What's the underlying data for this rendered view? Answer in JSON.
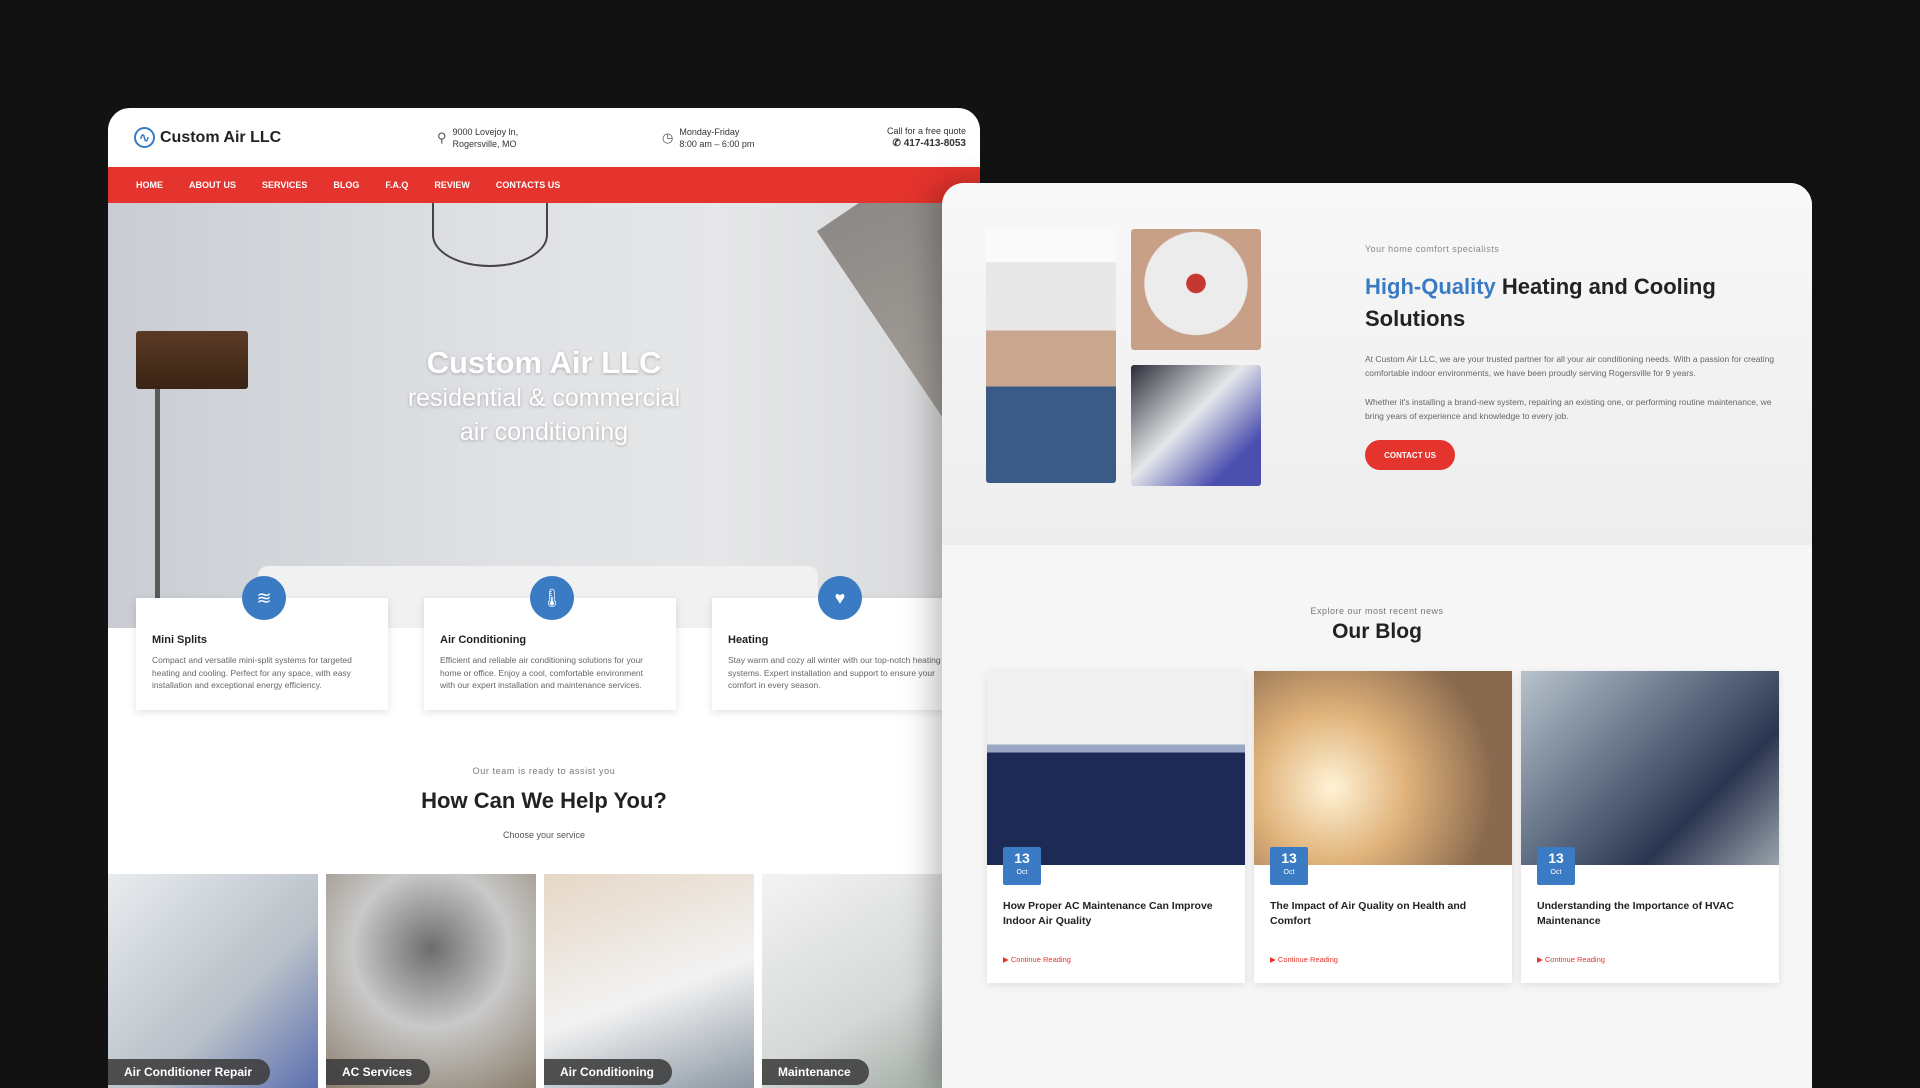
{
  "header": {
    "brand": "Custom Air LLC",
    "address_line1": "9000 Lovejoy ln,",
    "address_line2": "Rogersville, MO",
    "hours_line1": "Monday-Friday",
    "hours_line2": "8:00 am – 6:00 pm",
    "quote_label": "Call for a free quote",
    "phone": "417-413-8053"
  },
  "nav": [
    "HOME",
    "ABOUT US",
    "SERVICES",
    "BLOG",
    "F.A.Q",
    "REVIEW",
    "CONTACTS US"
  ],
  "hero": {
    "title": "Custom Air LLC",
    "subtitle_line1": "residential & commercial",
    "subtitle_line2": "air conditioning"
  },
  "features": [
    {
      "icon": "waves-icon",
      "glyph": "≋",
      "title": "Mini Splits",
      "text": "Compact and versatile mini-split systems for targeted heating and cooling. Perfect for any space, with easy installation and exceptional energy efficiency."
    },
    {
      "icon": "thermometer-icon",
      "glyph": "🌡",
      "title": "Air Conditioning",
      "text": "Efficient and reliable air conditioning solutions for your home or office. Enjoy a cool, comfortable environment with our expert installation and maintenance services."
    },
    {
      "icon": "heart-icon",
      "glyph": "♥",
      "title": "Heating",
      "text": "Stay warm and cozy all winter with our top-notch heating systems. Expert installation and support to ensure your comfort in every season."
    }
  ],
  "help": {
    "eyebrow": "Our team is ready to assist you",
    "title": "How Can We Help You?",
    "subtitle": "Choose your service"
  },
  "services": [
    "Air Conditioner Repair",
    "AC Services",
    "Air Conditioning",
    "Maintenance"
  ],
  "about": {
    "eyebrow": "Your home comfort specialists",
    "title_highlight": "High-Quality",
    "title_rest": " Heating and Cooling Solutions",
    "para1": "At Custom Air LLC, we are your trusted partner for all your air conditioning needs. With a passion for creating comfortable indoor environments, we have been proudly serving Rogersville for 9 years.",
    "para2": "Whether it's installing a brand-new system, repairing an existing one, or performing routine maintenance, we bring years of experience and knowledge to every job.",
    "cta": "CONTACT US"
  },
  "blog": {
    "eyebrow": "Explore our most recent news",
    "title": "Our Blog",
    "posts": [
      {
        "day": "13",
        "month": "Oct",
        "title": "How Proper AC Maintenance Can Improve Indoor Air Quality",
        "link": "Continue Reading"
      },
      {
        "day": "13",
        "month": "Oct",
        "title": "The Impact of Air Quality on Health and Comfort",
        "link": "Continue Reading"
      },
      {
        "day": "13",
        "month": "Oct",
        "title": "Understanding the Importance of HVAC Maintenance",
        "link": "Continue Reading"
      }
    ]
  },
  "colors": {
    "accent_red": "#e5332d",
    "accent_blue": "#3a7bc4",
    "background": "#121212"
  }
}
